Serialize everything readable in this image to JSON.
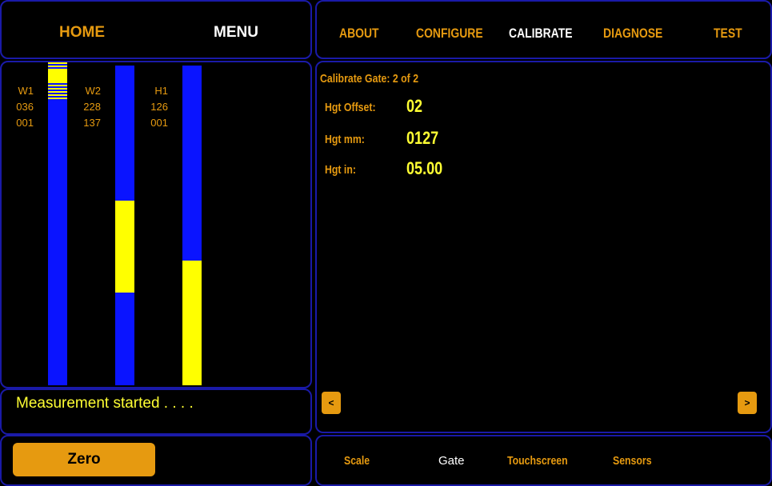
{
  "left_header": {
    "home": "HOME",
    "menu": "MENU"
  },
  "top_nav": [
    {
      "label": "ABOUT",
      "active": false
    },
    {
      "label": "CONFIGURE",
      "active": false
    },
    {
      "label": "CALIBRATE",
      "active": true
    },
    {
      "label": "DIAGNOSE",
      "active": false
    },
    {
      "label": "TEST",
      "active": false
    }
  ],
  "sensors": [
    {
      "name": "W1",
      "value1": "036",
      "value2": "001"
    },
    {
      "name": "W2",
      "value1": "228",
      "value2": "137"
    },
    {
      "name": "H1",
      "value1": "126",
      "value2": "001"
    }
  ],
  "status_message": "Measurement started . . . .",
  "zero_button": "Zero",
  "calibration": {
    "title": "Calibrate Gate: 2 of 2",
    "rows": [
      {
        "label": "Hgt Offset:",
        "value": "02"
      },
      {
        "label": "Hgt mm:",
        "value": "0127"
      },
      {
        "label": "Hgt in:",
        "value": "05.00"
      }
    ]
  },
  "pager": {
    "prev": "<",
    "next": ">"
  },
  "bottom_tabs": [
    {
      "label": "Scale",
      "active": false
    },
    {
      "label": "Gate",
      "active": true
    },
    {
      "label": "Touchscreen",
      "active": false
    },
    {
      "label": "Sensors",
      "active": false
    }
  ],
  "colors": {
    "accent": "#e69a10",
    "value": "#ffff33",
    "frame": "#1a1aa8",
    "bar": "#0a14ff",
    "fill": "#ffff00"
  }
}
